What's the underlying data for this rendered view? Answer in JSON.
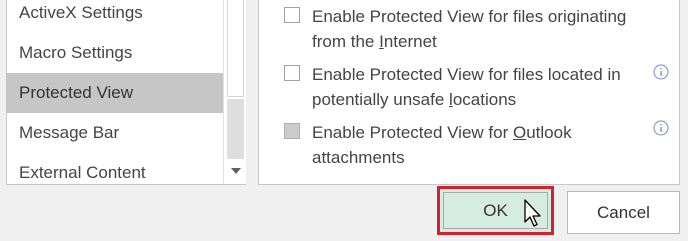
{
  "sidebar": {
    "items": [
      {
        "label": "ActiveX Settings",
        "selected": false
      },
      {
        "label": "Macro Settings",
        "selected": false
      },
      {
        "label": "Protected View",
        "selected": true
      },
      {
        "label": "Message Bar",
        "selected": false
      },
      {
        "label": "External Content",
        "selected": false
      }
    ]
  },
  "options": [
    {
      "line1": "Enable Protected View for files originating",
      "line2_pre": "from the ",
      "line2_accel": "I",
      "line2_post": "nternet",
      "checked": false,
      "disabled": false,
      "info_icon": false
    },
    {
      "line1": "Enable Protected View for files located in",
      "line2_pre": "potentially unsafe ",
      "line2_accel": "l",
      "line2_post": "ocations",
      "checked": false,
      "disabled": false,
      "info_icon": true
    },
    {
      "line1_pre": "Enable Protected View for ",
      "line1_accel": "O",
      "line1_post": "utlook",
      "line2": "attachments",
      "checked": false,
      "disabled": true,
      "info_icon": true
    }
  ],
  "buttons": {
    "ok_label": "OK",
    "cancel_label": "Cancel"
  },
  "colors": {
    "selected_item_bg": "#c6c6c6",
    "ok_highlight_border": "#d3232a",
    "ok_bg": "#d5ede0",
    "info_icon": "#6a8fc7"
  },
  "icons": {
    "info": "info-circle-icon",
    "scroll_down": "chevron-down-icon",
    "cursor": "mouse-pointer-icon"
  }
}
